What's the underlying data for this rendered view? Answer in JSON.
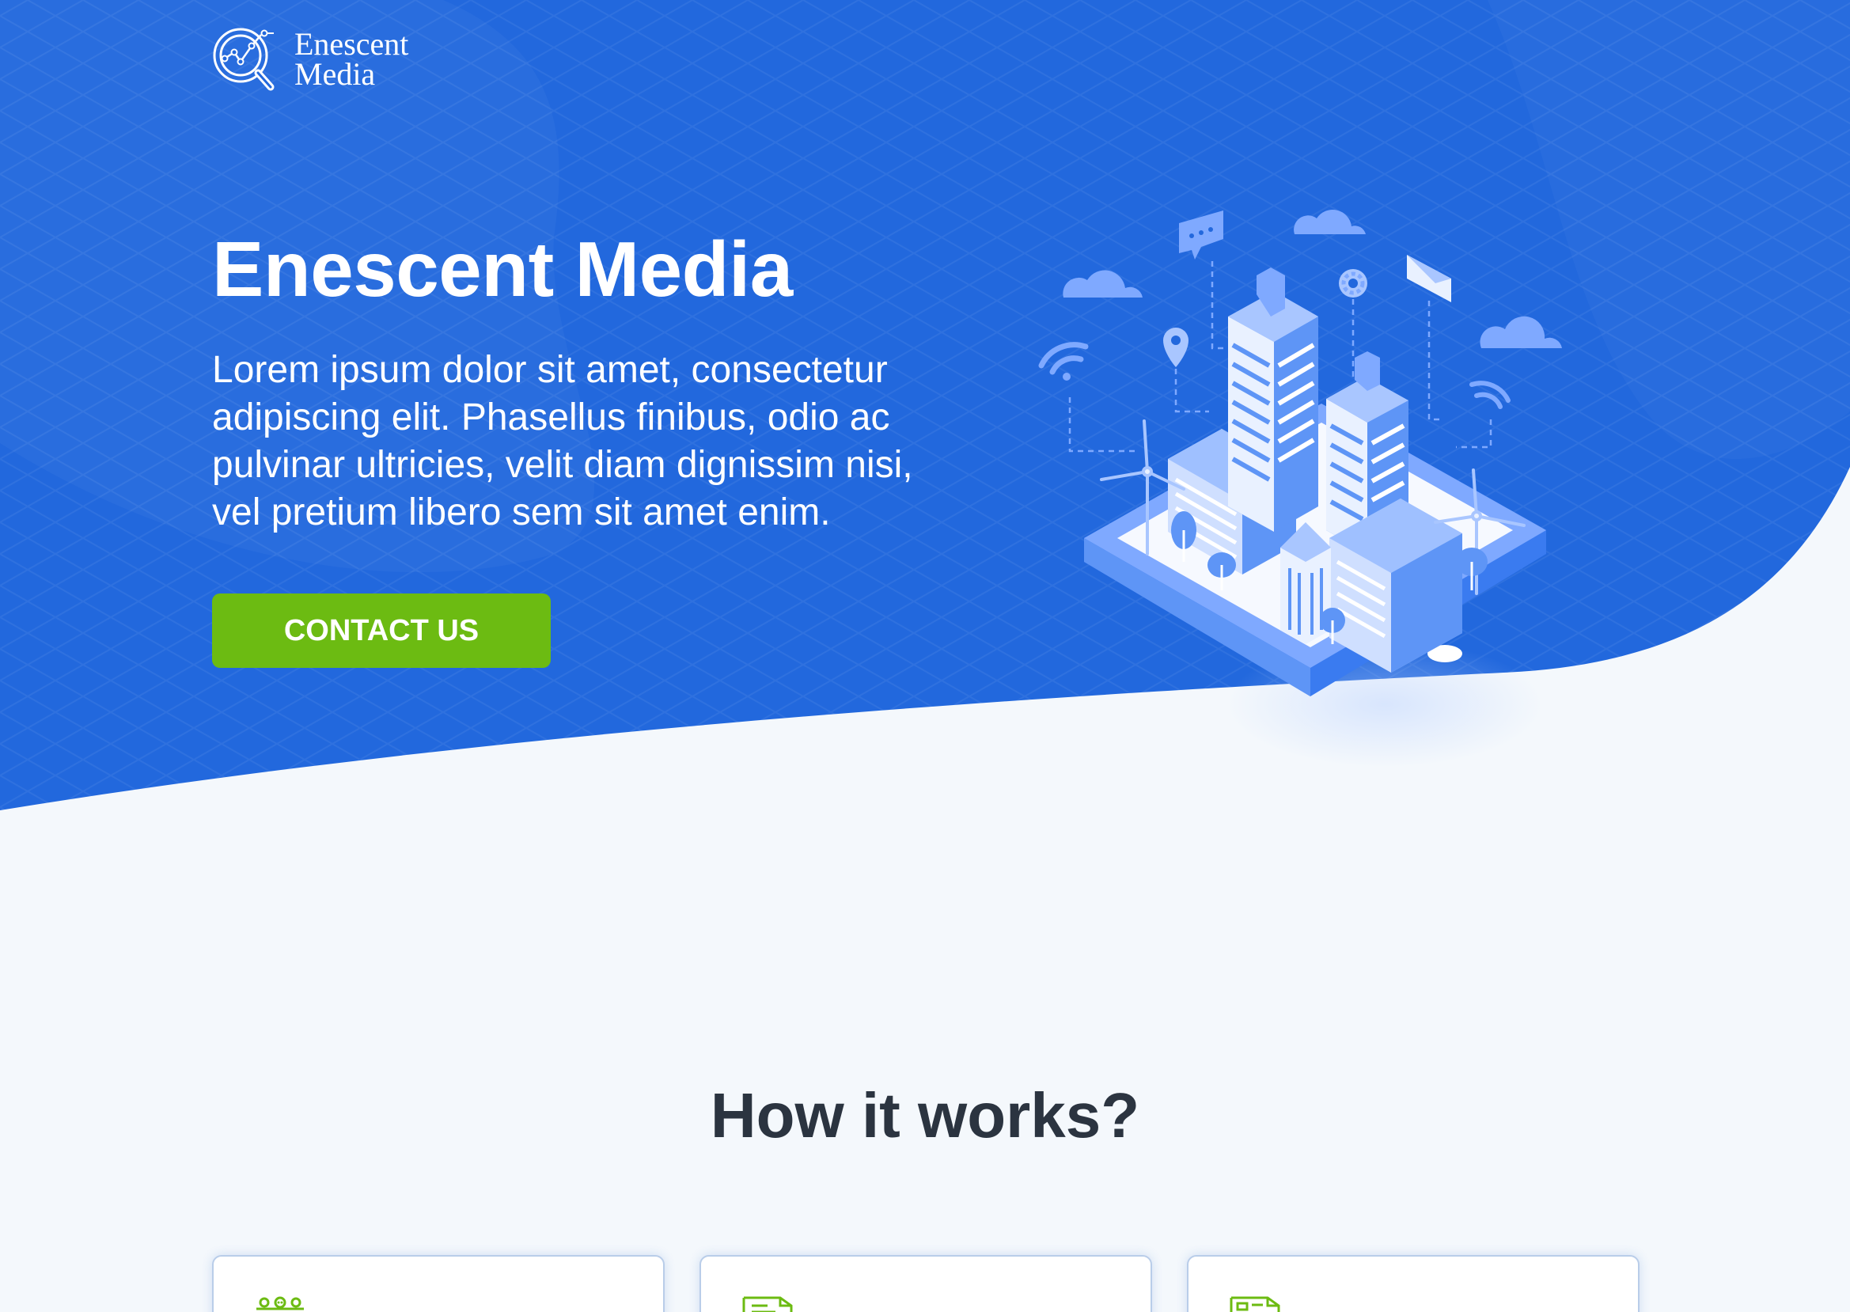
{
  "brand": {
    "name_line1": "Enescent",
    "name_line2": "Media"
  },
  "hero": {
    "title": "Enescent Media",
    "text": "Lorem ipsum dolor sit amet, consectetur adipiscing elit. Phasellus finibus, odio ac pulvinar ultricies, velit diam dignissim nisi, vel pretium libero sem sit amet enim.",
    "cta_label": "CONTACT US"
  },
  "how_it_works": {
    "title": "How it works?",
    "cards": [
      {
        "icon": "group-people-icon"
      },
      {
        "icon": "document-icon"
      },
      {
        "icon": "newspaper-icon"
      }
    ]
  },
  "colors": {
    "hero_blue": "#2268dd",
    "accent_green": "#6cbb12",
    "page_bg": "#f4f8fc",
    "title_dark": "#2b3440"
  }
}
